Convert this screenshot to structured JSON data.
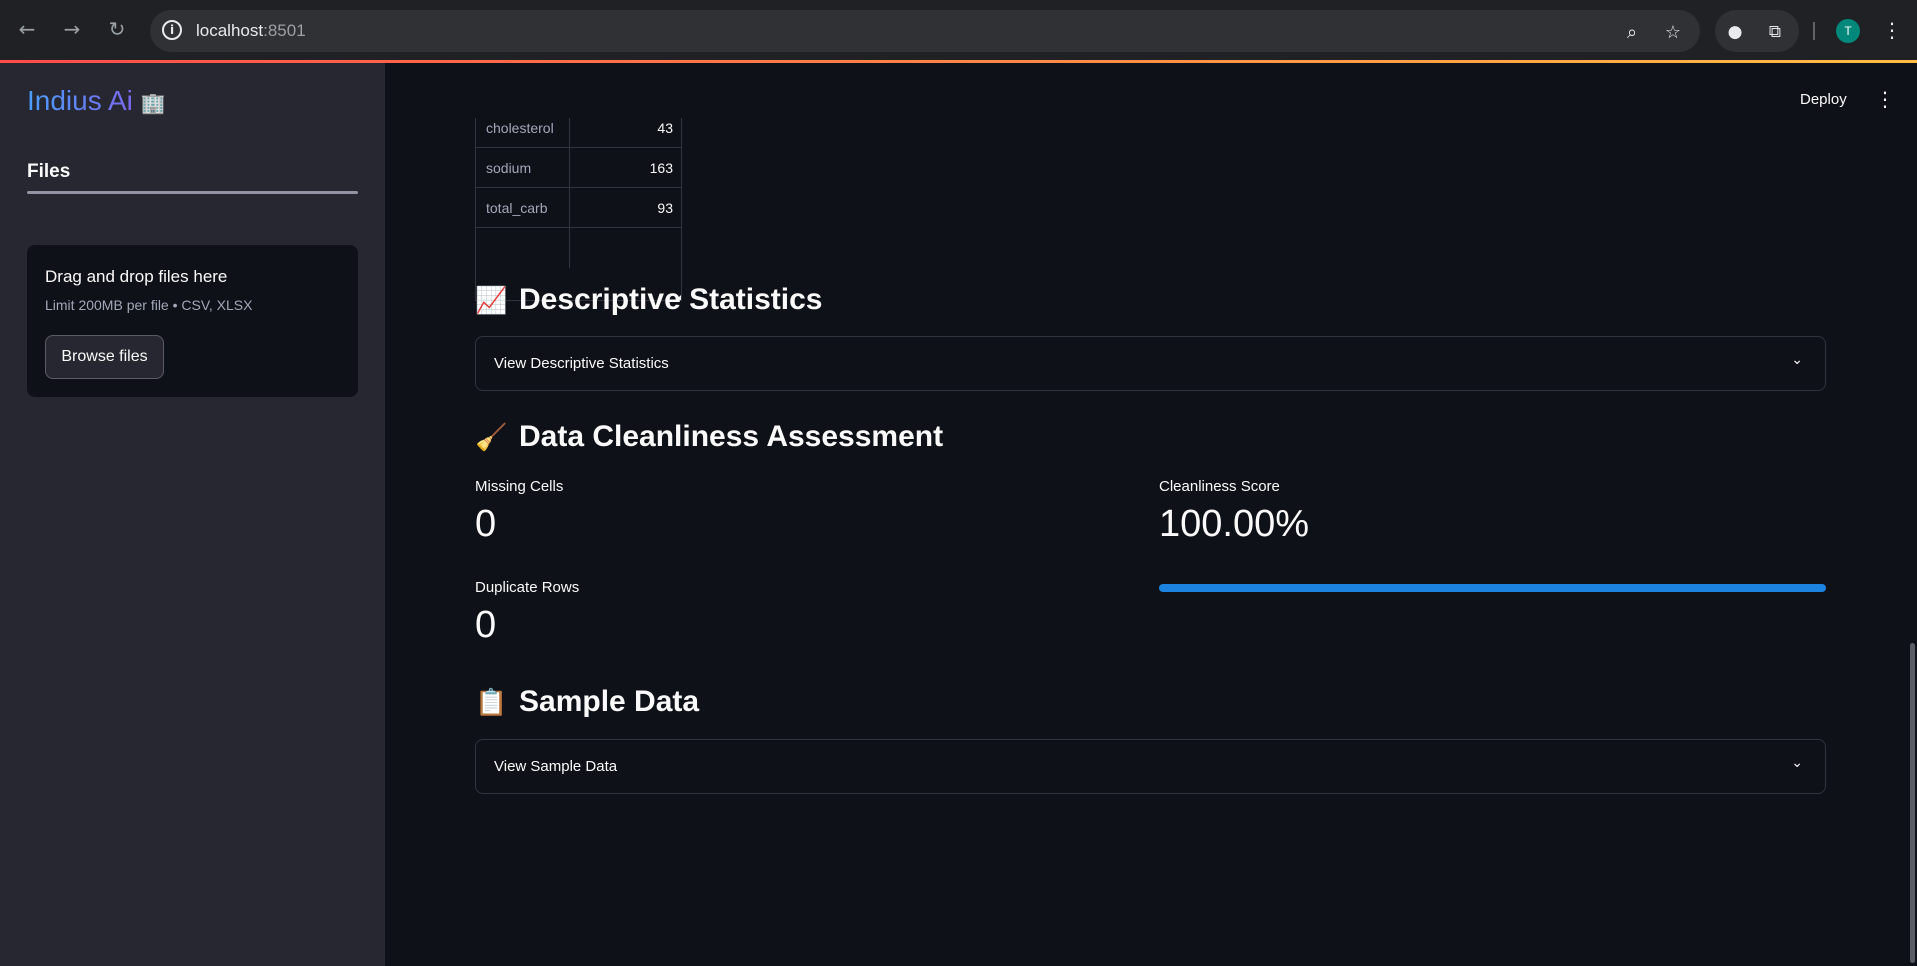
{
  "browser": {
    "url_host": "localhost",
    "url_port": ":8501",
    "profile_initial": "T"
  },
  "sidebar": {
    "brand_name": "Indius Ai",
    "brand_emoji": "🏢",
    "tab_label": "Files",
    "uploader": {
      "title": "Drag and drop files here",
      "limit": "Limit 200MB per file • CSV, XLSX",
      "button_label": "Browse files"
    }
  },
  "header": {
    "deploy_label": "Deploy"
  },
  "missing_table": {
    "rows": [
      {
        "name": "cholesterol",
        "value": "43"
      },
      {
        "name": "sodium",
        "value": "163"
      },
      {
        "name": "total_carb",
        "value": "93"
      }
    ]
  },
  "descriptive": {
    "emoji": "📈",
    "title": "Descriptive Statistics",
    "expander_label": "View Descriptive Statistics"
  },
  "cleanliness": {
    "emoji": "🧹",
    "title": "Data Cleanliness Assessment",
    "missing_label": "Missing Cells",
    "missing_value": "0",
    "duplicate_label": "Duplicate Rows",
    "duplicate_value": "0",
    "score_label": "Cleanliness Score",
    "score_value": "100.00%",
    "score_fraction": 1.0,
    "progress_color": "#1c83e1"
  },
  "sample": {
    "emoji": "📋",
    "title": "Sample Data",
    "expander_label": "View Sample Data"
  }
}
